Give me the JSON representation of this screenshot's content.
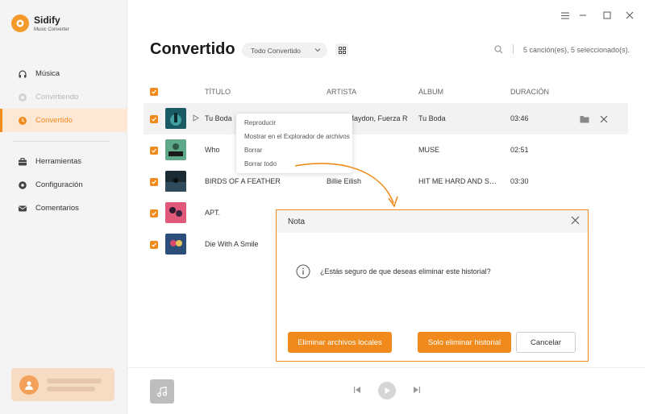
{
  "app": {
    "name": "Sidify",
    "subtitle": "Music Converter"
  },
  "sidebar": {
    "items": [
      {
        "label": "Música",
        "icon": "headphones-icon",
        "state": "normal"
      },
      {
        "label": "Convirtiendo",
        "icon": "sync-icon",
        "state": "disabled"
      },
      {
        "label": "Convertido",
        "icon": "clock-icon",
        "state": "active"
      },
      {
        "label": "Herramientas",
        "icon": "toolbox-icon",
        "state": "normal"
      },
      {
        "label": "Configuración",
        "icon": "gear-icon",
        "state": "normal"
      },
      {
        "label": "Comentarios",
        "icon": "mail-icon",
        "state": "normal"
      }
    ]
  },
  "header": {
    "title": "Convertido",
    "filter_value": "Todo Convertido",
    "count_text": "5 canción(es), 5 seleccionado(s)."
  },
  "table": {
    "columns": [
      "TÍTULO",
      "ARTISTA",
      "ÁLBUM",
      "DURACIÓN"
    ],
    "rows": [
      {
        "title": "Tu Boda",
        "artist": "Oscar Maydon, Fuerza Regida",
        "album": "Tu Boda",
        "duration": "03:46",
        "cover": "#1a5a62"
      },
      {
        "title": "Who",
        "artist": "",
        "album": "MUSE",
        "duration": "02:51",
        "cover": "#5fa88a"
      },
      {
        "title": "BIRDS OF A FEATHER",
        "artist": "Billie Eilish",
        "album": "HIT ME HARD AND SOFT",
        "duration": "03:30",
        "cover": "#1c2a33"
      },
      {
        "title": "APT.",
        "artist": "",
        "album": "",
        "duration": "",
        "cover": "#e0587a"
      },
      {
        "title": "Die With A Smile",
        "artist": "",
        "album": "",
        "duration": "",
        "cover": "#2b4f7a"
      }
    ]
  },
  "context_menu": {
    "items": [
      "Reproducir",
      "Mostrar en el Explorador de archivos",
      "Borrar",
      "Borrar todo"
    ]
  },
  "dialog": {
    "title": "Nota",
    "message": "¿Estás seguro de que deseas eliminar este historial?",
    "btn_delete_local": "Eliminar archivos locales",
    "btn_only_history": "Solo eliminar historial",
    "btn_cancel": "Cancelar"
  },
  "colors": {
    "accent": "#f08a1c",
    "sidebar_bg": "#f4f4f4"
  }
}
